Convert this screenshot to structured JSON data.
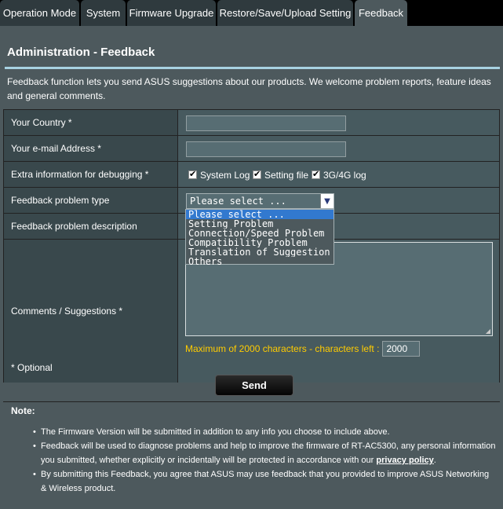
{
  "tabs": [
    {
      "label": "Operation Mode"
    },
    {
      "label": "System"
    },
    {
      "label": "Firmware Upgrade"
    },
    {
      "label": "Restore/Save/Upload Setting"
    },
    {
      "label": "Feedback"
    }
  ],
  "page": {
    "title": "Administration - Feedback",
    "intro": "Feedback function lets you send ASUS suggestions about our products. We welcome problem reports, feature ideas and general comments."
  },
  "form": {
    "country_label": "Your Country *",
    "country_value": "",
    "email_label": "Your e-mail Address *",
    "email_value": "",
    "debug_label": "Extra information for debugging *",
    "debug_options": [
      "System Log",
      "Setting file",
      "3G/4G log"
    ],
    "type_label": "Feedback problem type",
    "type_selected": "Please select ...",
    "type_options": [
      "Please select ...",
      "Setting Problem",
      "Connection/Speed Problem",
      "Compatibility Problem",
      "Translation of Suggestion",
      "Others"
    ],
    "description_label": "Feedback problem description",
    "comments_label": "Comments / Suggestions *",
    "max_text": "Maximum of 2000 characters - characters left :",
    "chars_left": "2000"
  },
  "optional_text": "* Optional",
  "send_label": "Send",
  "note": {
    "title": "Note:",
    "item1": "The Firmware Version will be submitted in addition to any info you choose to include above.",
    "item2_pre": "Feedback will be used to diagnose problems and help to improve the firmware of RT-AC5300, any personal information you submitted, whether explicitly or incidentally will be protected in accordance with our ",
    "item2_link": "privacy policy",
    "item2_post": ".",
    "item3": "By submitting this Feedback, you agree that ASUS may use feedback that you provided to improve ASUS Networking & Wireless product."
  },
  "colors": {
    "panel": "#4d595d",
    "accent_rule": "#a7d2e2",
    "highlight": "#3279cf",
    "warning_text": "#ffcc00"
  }
}
